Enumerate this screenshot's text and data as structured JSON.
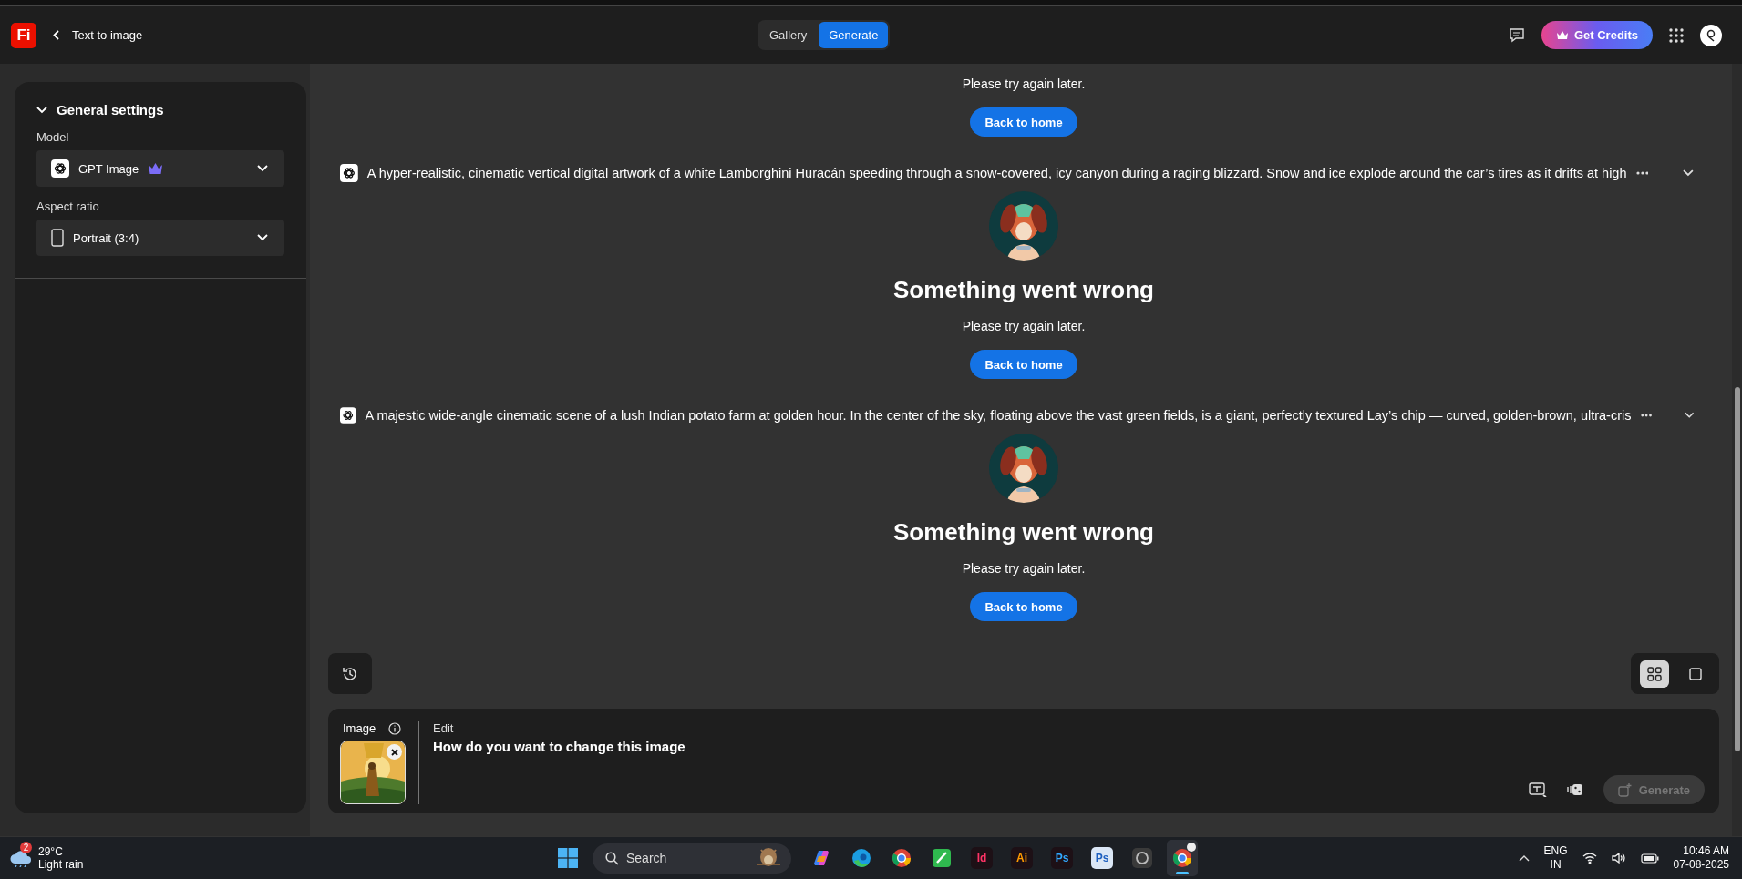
{
  "app": {
    "logo": "Fi",
    "back_label": "Text to image"
  },
  "view_switch": [
    {
      "label": "Gallery",
      "selected": false
    },
    {
      "label": "Generate",
      "selected": true
    }
  ],
  "header": {
    "credits": "Get Credits"
  },
  "settings": {
    "title": "General settings",
    "expanded": true,
    "fields": [
      {
        "label": "Model",
        "value": "GPT Image",
        "kind": "model",
        "premium": true
      },
      {
        "label": "Aspect ratio",
        "value": "Portrait (3:4)",
        "kind": "ratio",
        "premium": false
      }
    ]
  },
  "results": [
    {
      "kind": "partial",
      "message": "Please try again later.",
      "button": "Back to home"
    },
    {
      "kind": "error",
      "prompt": "A hyper-realistic, cinematic vertical digital artwork of a white Lamborghini Huracán speeding through a snow-covered, icy canyon during a raging blizzard. Snow and ice explode around the car’s tires as it drifts at high",
      "title": "Something went wrong",
      "message": "Please try again later.",
      "button": "Back to home"
    },
    {
      "kind": "error",
      "prompt": "A majestic wide-angle cinematic scene of a lush Indian potato farm at golden hour. In the center of the sky, floating above the vast green fields, is a giant, perfectly textured Lay’s chip — curved, golden-brown, ultra-cris",
      "title": "Something went wrong",
      "message": "Please try again later.",
      "button": "Back to home"
    }
  ],
  "layout_toggle": [
    {
      "kind": "grid",
      "selected": true
    },
    {
      "kind": "single",
      "selected": false
    }
  ],
  "composer": {
    "image_label": "Image",
    "edit_label": "Edit",
    "value": "How do you want to change this image",
    "generate": "Generate",
    "generate_disabled": true
  },
  "taskbar": {
    "weather": {
      "badge": "2",
      "temperature": "29°C",
      "condition": "Light rain"
    },
    "search": {
      "placeholder": "Search"
    },
    "apps": [
      {
        "kind": "copilot",
        "active": false
      },
      {
        "kind": "edge",
        "active": false
      },
      {
        "kind": "chrome",
        "active": false
      },
      {
        "kind": "sheet",
        "active": false
      },
      {
        "kind": "letter",
        "label": "Id",
        "color": "#ff3366",
        "active": false
      },
      {
        "kind": "letter",
        "label": "Ai",
        "color": "#ff9a00",
        "active": false
      },
      {
        "kind": "letter",
        "label": "Ps",
        "color": "#31a8ff",
        "active": false
      },
      {
        "kind": "letter-light",
        "label": "Ps",
        "color": "#1d5fbf",
        "active": false
      },
      {
        "kind": "circle",
        "active": false
      },
      {
        "kind": "chrome",
        "active": true
      }
    ],
    "language": "ENG",
    "region": "IN",
    "time": "10:46 AM",
    "date": "07-08-2025"
  }
}
